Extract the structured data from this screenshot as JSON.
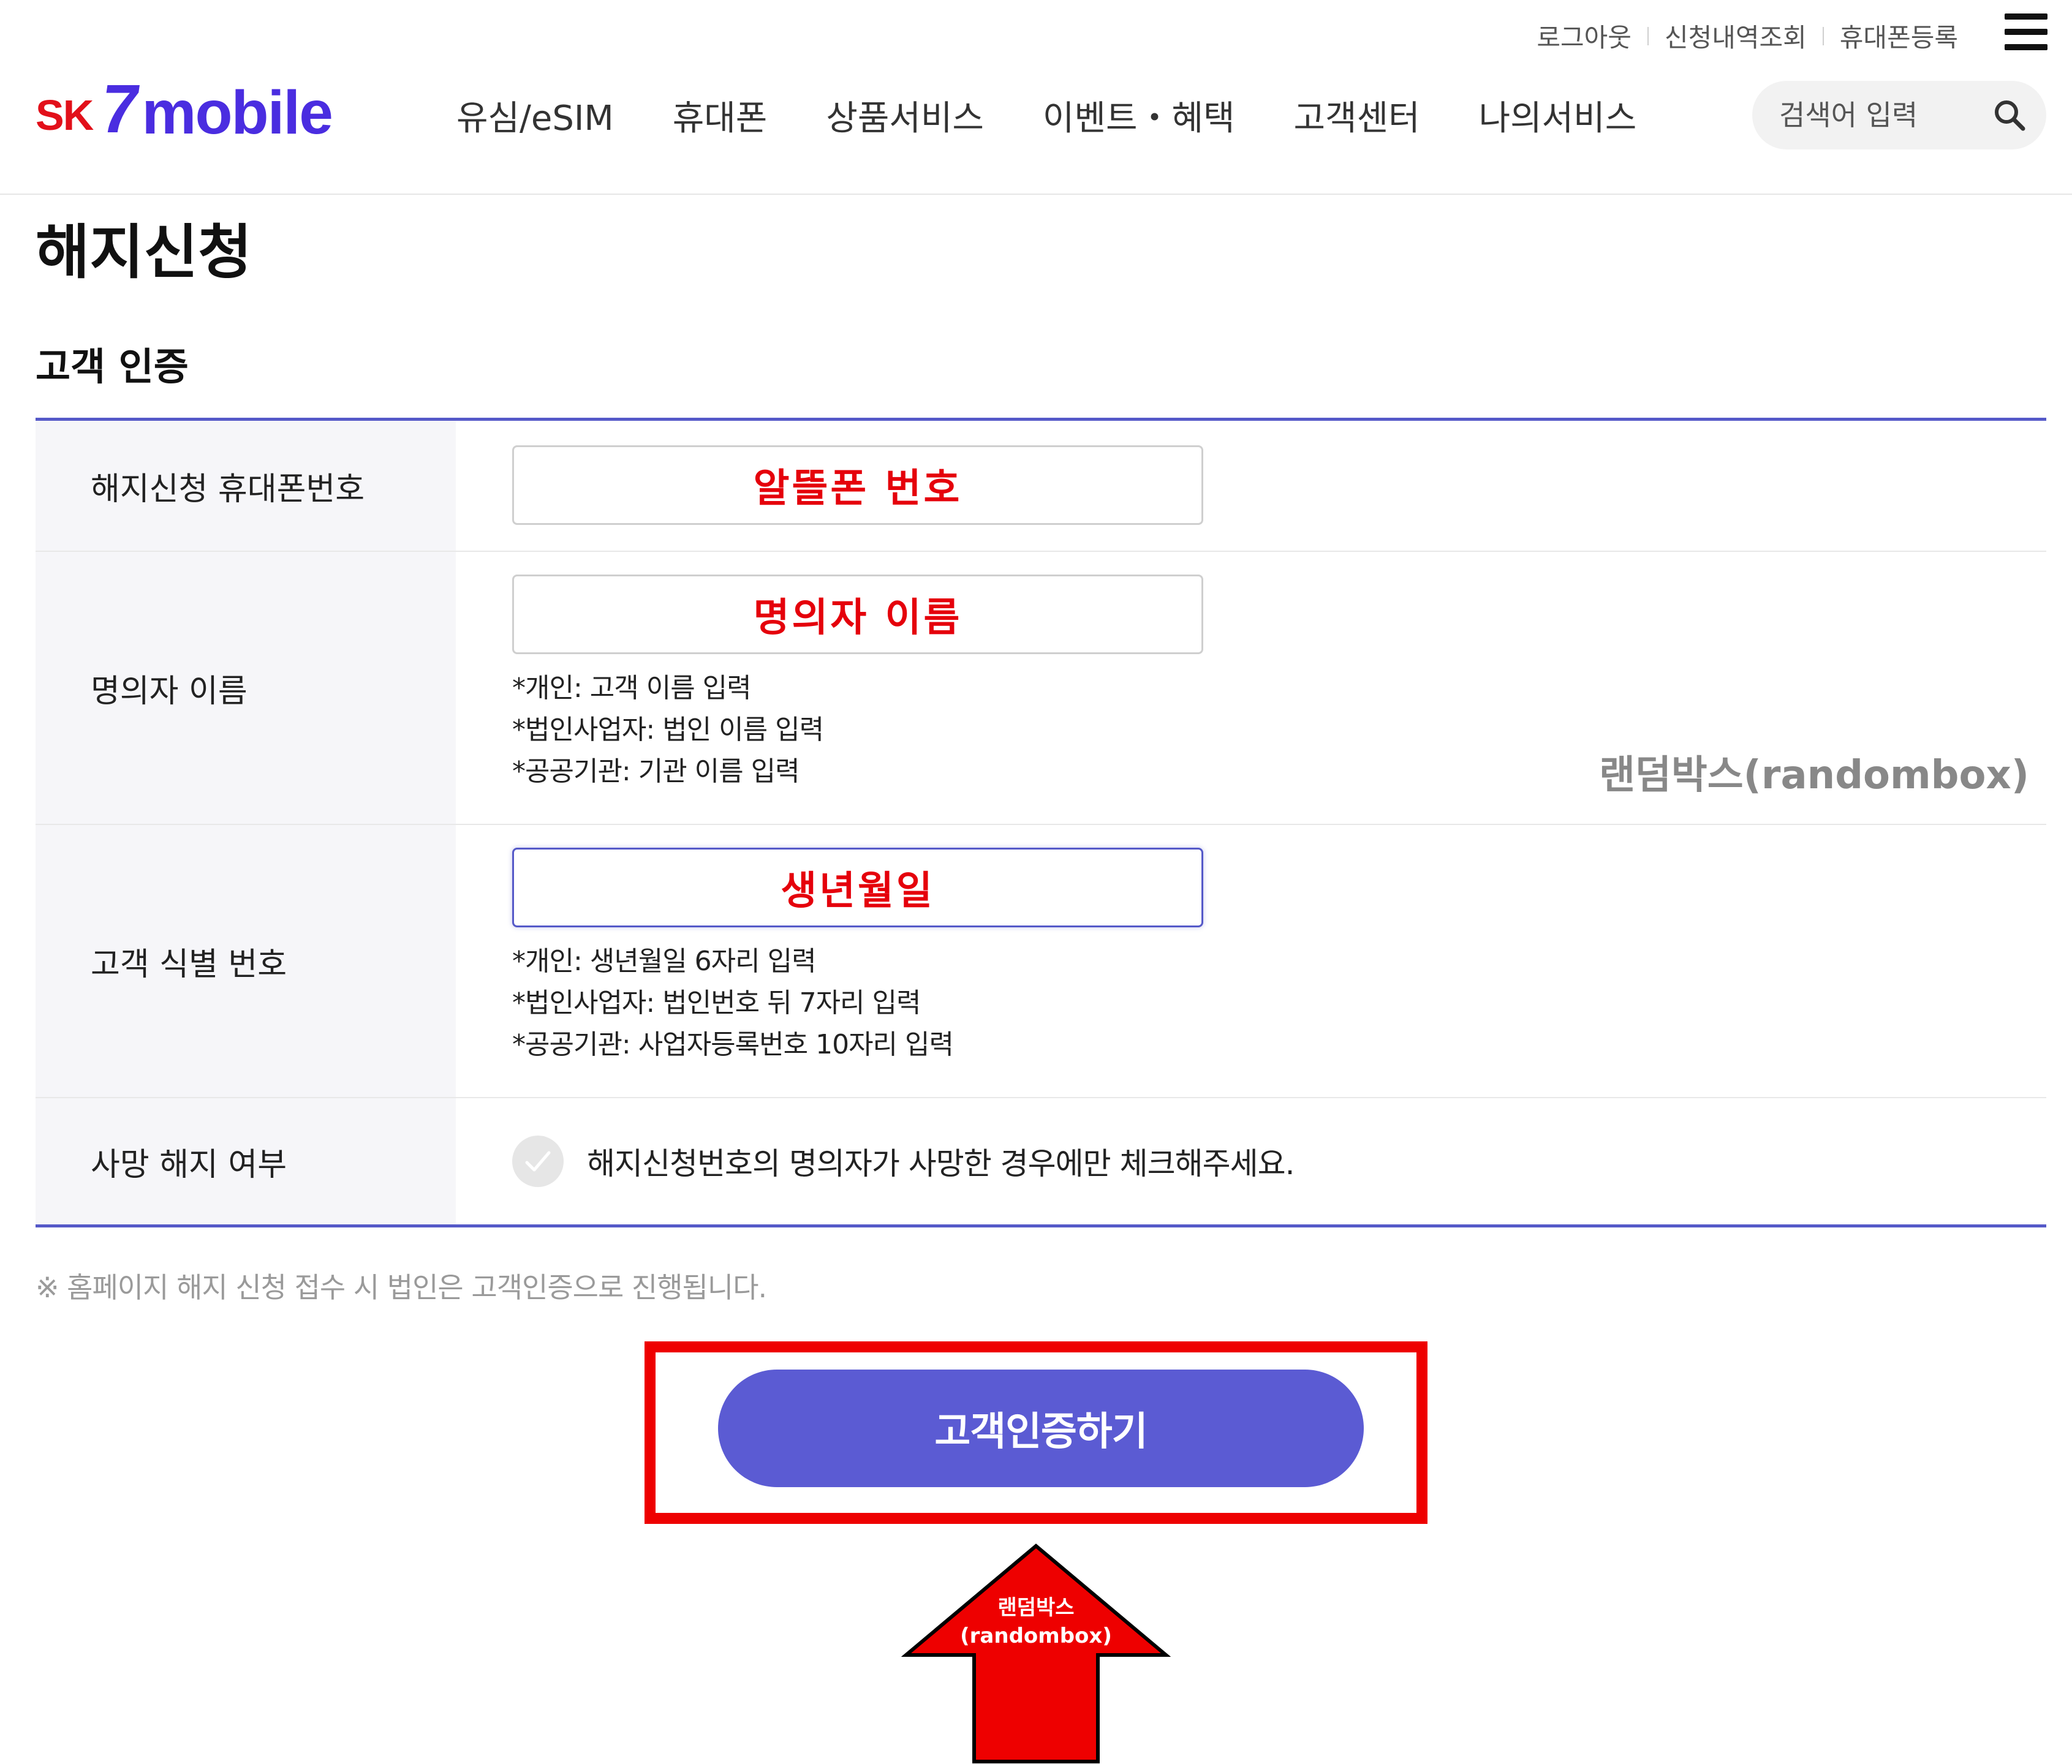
{
  "header": {
    "util_links": [
      "로그아웃",
      "신청내역조회",
      "휴대폰등록"
    ],
    "logo": {
      "sk": "SK",
      "seven": "7",
      "mobile": "mobile"
    },
    "nav": [
      "유심/eSIM",
      "휴대폰",
      "상품서비스",
      "이벤트・혜택",
      "고객센터",
      "나의서비스"
    ],
    "search_placeholder": "검색어 입력"
  },
  "page_title": "해지신청",
  "section_title": "고객 인증",
  "form": {
    "phone": {
      "label": "해지신청 휴대폰번호",
      "value": "알뜰폰 번호"
    },
    "name": {
      "label": "명의자 이름",
      "value": "명의자 이름",
      "hints": [
        "*개인: 고객 이름 입력",
        "*법인사업자: 법인 이름 입력",
        "*공공기관: 기관 이름 입력"
      ]
    },
    "id": {
      "label": "고객 식별 번호",
      "value": "생년월일",
      "hints": [
        "*개인: 생년월일 6자리 입력",
        "*법인사업자: 법인번호 뒤 7자리 입력",
        "*공공기관: 사업자등록번호 10자리 입력"
      ]
    },
    "death": {
      "label": "사망 해지 여부",
      "checkbox_text": "해지신청번호의 명의자가 사망한 경우에만 체크해주세요.",
      "checked": false
    }
  },
  "annotation_label": "랜덤박스(randombox)",
  "notice": "※ 홈페이지 해지 신청 접수 시 법인은 고객인증으로 진행됩니다.",
  "verify_button": "고객인증하기",
  "arrow_label": {
    "line1": "랜덤박스",
    "line2": "(randombox)"
  },
  "colors": {
    "accent": "#5b5bd3",
    "annotation_red": "#ee0000",
    "input_text_red": "#e5000b",
    "brand_purple": "#4a2de0",
    "brand_red": "#e2101a"
  }
}
